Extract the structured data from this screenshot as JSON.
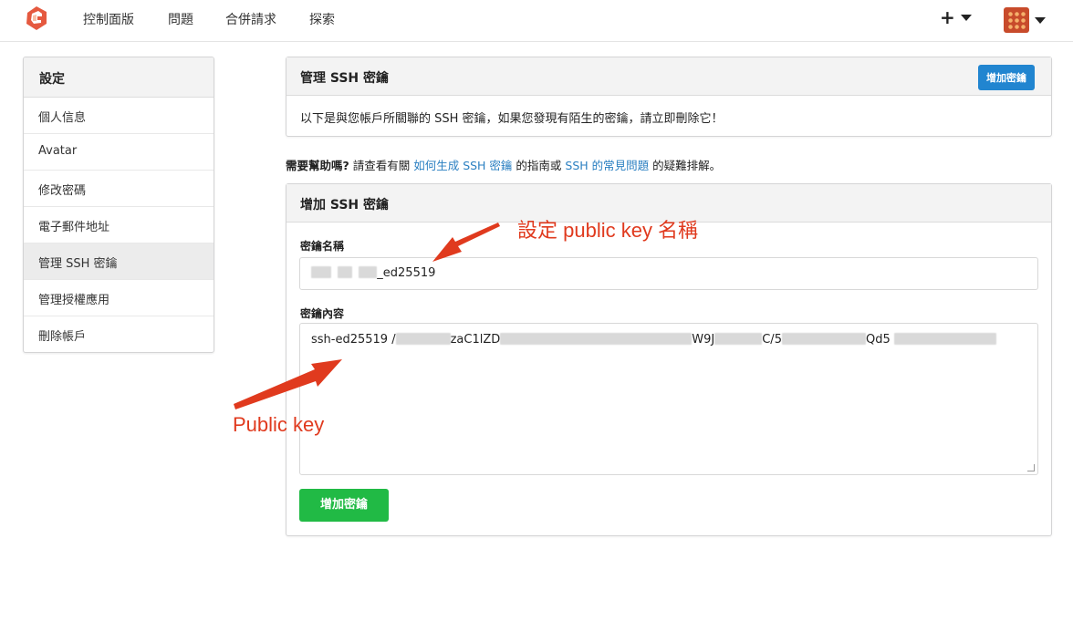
{
  "nav": {
    "items": [
      "控制面版",
      "問題",
      "合併請求",
      "探索"
    ],
    "plus": "+"
  },
  "sidebar": {
    "header": "設定",
    "items": [
      {
        "label": "個人信息"
      },
      {
        "label": "Avatar"
      },
      {
        "label": "修改密碼"
      },
      {
        "label": "電子郵件地址"
      },
      {
        "label": "管理 SSH 密鑰",
        "active": true
      },
      {
        "label": "管理授權應用"
      },
      {
        "label": "刪除帳戶"
      }
    ]
  },
  "manage": {
    "title": "管理 SSH 密鑰",
    "add_button": "增加密鑰",
    "description": "以下是與您帳戶所關聯的 SSH 密鑰，如果您發現有陌生的密鑰，請立即刪除它！"
  },
  "help": {
    "question": "需要幫助嗎?",
    "text1": " 請查看有關 ",
    "link1": "如何生成 SSH 密鑰",
    "text2": " 的指南或 ",
    "link2": "SSH 的常見問題",
    "text3": " 的疑難排解。"
  },
  "add_key": {
    "title": "增加 SSH 密鑰",
    "name_label": "密鑰名稱",
    "name_suffix": "_ed25519",
    "content_label": "密鑰內容",
    "content_parts": [
      "ssh-ed25519 /",
      "zaC1lZD",
      "W9J",
      "C/5",
      "Qd5"
    ],
    "submit": "增加密鑰"
  },
  "annotations": {
    "name_note": "設定 public key 名稱",
    "key_note": "Public key"
  },
  "colors": {
    "annotation": "#e03a1e",
    "link": "#2a7fc1",
    "primary": "#2185d0",
    "success": "#21ba45"
  }
}
